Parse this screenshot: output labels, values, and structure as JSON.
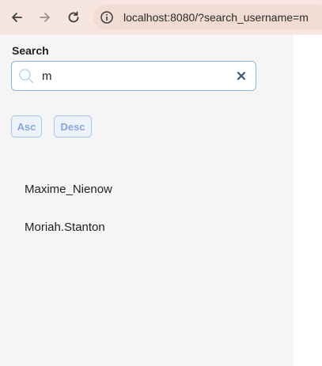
{
  "browser": {
    "url": "localhost:8080/?search_username=m"
  },
  "search": {
    "label": "Search",
    "value": "m",
    "placeholder": ""
  },
  "sort": {
    "asc_label": "Asc",
    "desc_label": "Desc"
  },
  "results": [
    {
      "username": "Maxime_Nienow"
    },
    {
      "username": "Moriah.Stanton"
    }
  ],
  "icons": {
    "back": "arrow-left-icon",
    "forward": "arrow-right-icon",
    "reload": "reload-icon",
    "info": "info-icon",
    "search": "search-icon",
    "clear": "close-icon"
  },
  "colors": {
    "toolbar_bg": "#f7e6df",
    "panel_bg": "#f5f5f6",
    "accent_border": "#8fb4e0",
    "button_text": "#86a7d6"
  }
}
